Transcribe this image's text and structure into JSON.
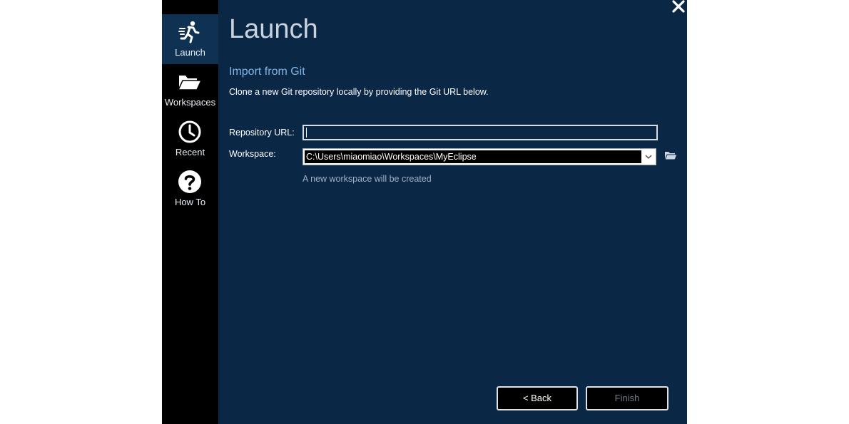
{
  "sidebar": {
    "items": [
      {
        "label": "Launch",
        "icon": "running-person-icon",
        "active": true
      },
      {
        "label": "Workspaces",
        "icon": "folder-open-icon",
        "active": false
      },
      {
        "label": "Recent",
        "icon": "clock-icon",
        "active": false
      },
      {
        "label": "How To",
        "icon": "question-circle-icon",
        "active": false
      }
    ]
  },
  "header": {
    "title": "Launch",
    "close_icon": "close-icon"
  },
  "main": {
    "section_title": "Import from Git",
    "description": "Clone a new Git repository locally by providing the Git URL below.",
    "repo_url": {
      "label": "Repository URL:",
      "value": ""
    },
    "workspace": {
      "label": "Workspace:",
      "value": "C:\\Users\\miaomiao\\Workspaces\\MyEclipse",
      "hint": "A new workspace will be created"
    }
  },
  "footer": {
    "back_label": "< Back",
    "finish_label": "Finish"
  },
  "colors": {
    "window_bg": "#0b2746",
    "sidebar_bg": "#000000",
    "active_item_bg": "#0f3152",
    "accent": "#7fb6e6"
  }
}
